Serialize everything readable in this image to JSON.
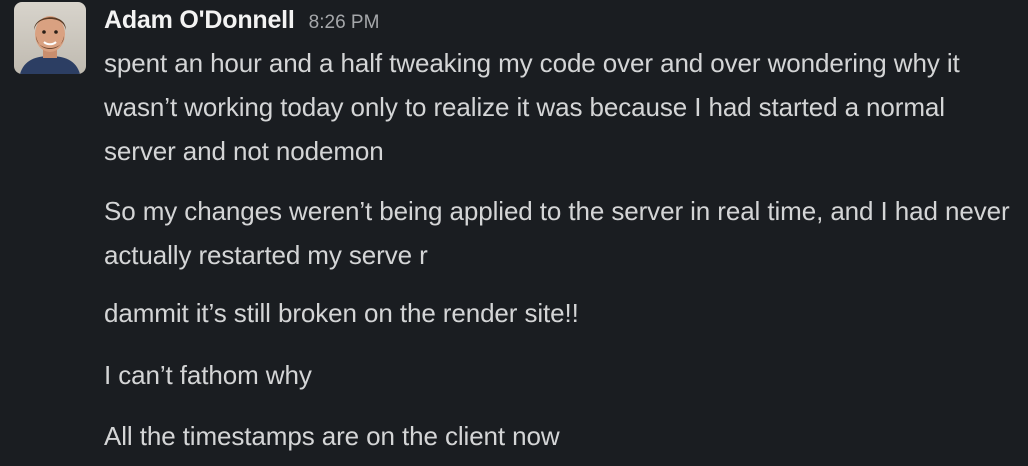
{
  "message": {
    "author": "Adam O'Donnell",
    "timestamp": "8:26 PM",
    "avatar": "user-avatar-photo",
    "lines": [
      "spent an hour and a half tweaking my code over and over wondering why it wasn’t working today only to realize it was because I had started a normal server and not nodemon",
      "So my changes weren’t being applied to the server in real time, and I had never actually restarted my serve r",
      "dammit it’s still broken on the render site!!",
      "I can’t fathom why",
      "All the timestamps are on the client now"
    ]
  },
  "colors": {
    "background": "#1a1d21",
    "author": "#f3f3f3",
    "timestamp": "#a5a7aa",
    "text": "#d4d5d6"
  }
}
